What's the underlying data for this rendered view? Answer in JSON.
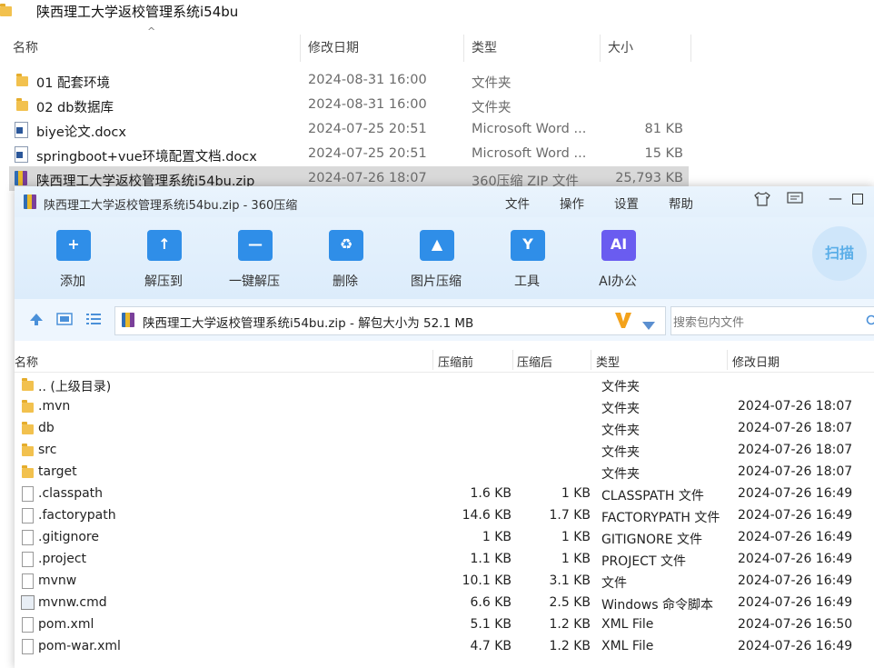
{
  "explorer": {
    "title": "陕西理工大学返校管理系统i54bu",
    "columns": [
      "名称",
      "修改日期",
      "类型",
      "大小"
    ],
    "rows": [
      {
        "name": "01 配套环境",
        "date": "2024-08-31 16:00",
        "type": "文件夹",
        "size": "",
        "icon": "folder-icon"
      },
      {
        "name": "02 db数据库",
        "date": "2024-08-31 16:00",
        "type": "文件夹",
        "size": "",
        "icon": "folder-icon"
      },
      {
        "name": "biye论文.docx",
        "date": "2024-07-25 20:51",
        "type": "Microsoft Word ...",
        "size": "81 KB",
        "icon": "word-doc-icon"
      },
      {
        "name": "springboot+vue环境配置文档.docx",
        "date": "2024-07-25 20:51",
        "type": "Microsoft Word ...",
        "size": "15 KB",
        "icon": "word-doc-icon"
      },
      {
        "name": "陕西理工大学返校管理系统i54bu.zip",
        "date": "2024-07-26 18:07",
        "type": "360压缩 ZIP 文件",
        "size": "25,793 KB",
        "icon": "zip-archive-icon",
        "selected": true
      }
    ]
  },
  "archive": {
    "title": "陕西理工大学返校管理系统i54bu.zip - 360压缩",
    "menu": [
      "文件",
      "操作",
      "设置",
      "帮助"
    ],
    "toolbar": [
      {
        "label": "添加",
        "icon": "add-icon",
        "color": "#2f8ee8"
      },
      {
        "label": "解压到",
        "icon": "extract-to-icon",
        "color": "#2f8ee8"
      },
      {
        "label": "一键解压",
        "icon": "one-click-extract-icon",
        "color": "#2f8ee8"
      },
      {
        "label": "删除",
        "icon": "delete-icon",
        "color": "#2f8ee8"
      },
      {
        "label": "图片压缩",
        "icon": "image-compress-icon",
        "color": "#2f8ee8"
      },
      {
        "label": "工具",
        "icon": "tools-icon",
        "color": "#2f8ee8"
      },
      {
        "label": "AI办公",
        "icon": "ai-office-icon",
        "color": "#6a5cf0"
      }
    ],
    "scan_label": "扫描",
    "address": "陕西理工大学返校管理系统i54bu.zip - 解包大小为 52.1 MB",
    "search_placeholder": "搜索包内文件",
    "columns": [
      "名称",
      "压缩前",
      "压缩后",
      "类型",
      "修改日期"
    ],
    "rows": [
      {
        "name": ".. (上级目录)",
        "before": "",
        "after": "",
        "type": "文件夹",
        "date": "",
        "icon": "folder-icon"
      },
      {
        "name": ".mvn",
        "before": "",
        "after": "",
        "type": "文件夹",
        "date": "2024-07-26 18:07",
        "icon": "folder-icon"
      },
      {
        "name": "db",
        "before": "",
        "after": "",
        "type": "文件夹",
        "date": "2024-07-26 18:07",
        "icon": "folder-icon"
      },
      {
        "name": "src",
        "before": "",
        "after": "",
        "type": "文件夹",
        "date": "2024-07-26 18:07",
        "icon": "folder-icon"
      },
      {
        "name": "target",
        "before": "",
        "after": "",
        "type": "文件夹",
        "date": "2024-07-26 18:07",
        "icon": "folder-icon"
      },
      {
        "name": ".classpath",
        "before": "1.6 KB",
        "after": "1 KB",
        "type": "CLASSPATH 文件",
        "date": "2024-07-26 16:49",
        "icon": "file-icon"
      },
      {
        "name": ".factorypath",
        "before": "14.6 KB",
        "after": "1.7 KB",
        "type": "FACTORYPATH 文件",
        "date": "2024-07-26 16:49",
        "icon": "file-icon"
      },
      {
        "name": ".gitignore",
        "before": "1 KB",
        "after": "1 KB",
        "type": "GITIGNORE 文件",
        "date": "2024-07-26 16:49",
        "icon": "file-icon"
      },
      {
        "name": ".project",
        "before": "1.1 KB",
        "after": "1 KB",
        "type": "PROJECT 文件",
        "date": "2024-07-26 16:49",
        "icon": "file-icon"
      },
      {
        "name": "mvnw",
        "before": "10.1 KB",
        "after": "3.1 KB",
        "type": "文件",
        "date": "2024-07-26 16:49",
        "icon": "file-icon"
      },
      {
        "name": "mvnw.cmd",
        "before": "6.6 KB",
        "after": "2.5 KB",
        "type": "Windows 命令脚本",
        "date": "2024-07-26 16:49",
        "icon": "cmd-script-icon"
      },
      {
        "name": "pom.xml",
        "before": "5.1 KB",
        "after": "1.2 KB",
        "type": "XML File",
        "date": "2024-07-26 16:50",
        "icon": "file-icon"
      },
      {
        "name": "pom-war.xml",
        "before": "4.7 KB",
        "after": "1.2 KB",
        "type": "XML File",
        "date": "2024-07-26 16:49",
        "icon": "file-icon"
      }
    ]
  }
}
